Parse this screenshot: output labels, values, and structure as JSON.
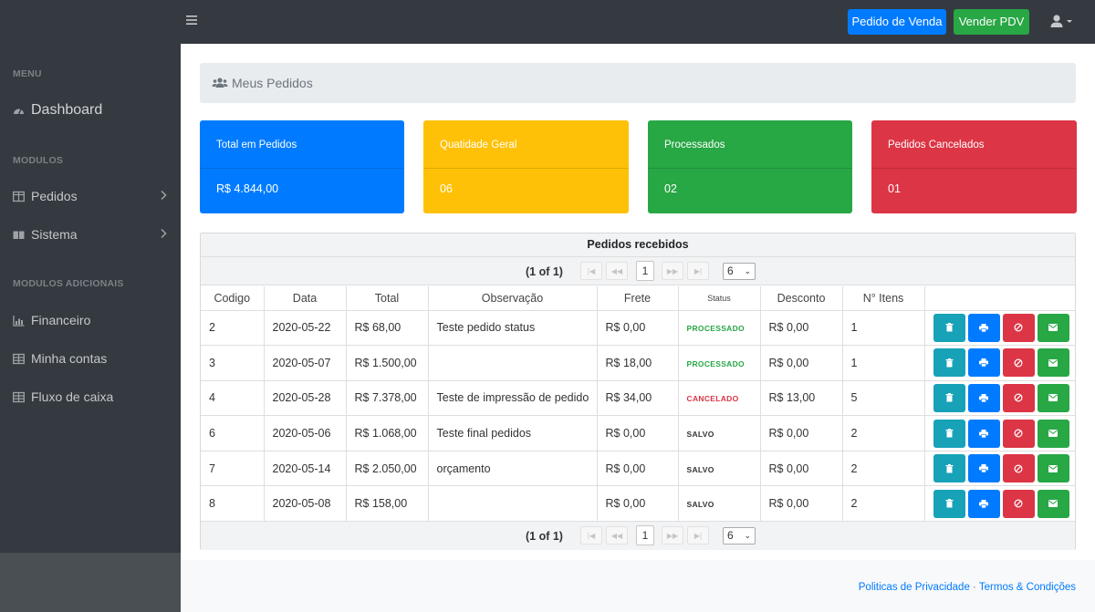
{
  "topbar": {
    "menu_icon": "hamburger-icon",
    "btn_pedido": "Pedido de Venda",
    "btn_pdv": "Vender PDV",
    "user_icon": "user-icon"
  },
  "sidebar": {
    "heading_menu": "MENU",
    "dashboard": "Dashboard",
    "heading_modulos": "MODULOS",
    "pedidos": "Pedidos",
    "sistema": "Sistema",
    "heading_adicionais": "MODULOS ADICIONAIS",
    "financeiro": "Financeiro",
    "minha_contas": "Minha contas",
    "fluxo_caixa": "Fluxo de caixa"
  },
  "breadcrumb": {
    "title": "Meus Pedidos",
    "icon": "users-icon"
  },
  "cards": [
    {
      "title": "Total em Pedidos",
      "value": "R$ 4.844,00",
      "color": "#007bff"
    },
    {
      "title": "Quatidade Geral",
      "value": "06",
      "color": "#ffc107"
    },
    {
      "title": "Processados",
      "value": "02",
      "color": "#28a745"
    },
    {
      "title": "Pedidos Cancelados",
      "value": "01",
      "color": "#dc3545"
    }
  ],
  "table": {
    "title": "Pedidos recebidos",
    "page_count": "(1 of 1)",
    "current_page": "1",
    "rows_per_page": "6",
    "columns": [
      "Codigo",
      "Data",
      "Total",
      "Observação",
      "Frete",
      "Status",
      "Desconto",
      "N° Itens",
      ""
    ],
    "rows": [
      {
        "codigo": "2",
        "data": "2020-05-22",
        "total": "R$ 68,00",
        "obs": "Teste pedido status",
        "frete": "R$ 0,00",
        "status": "PROCESSADO",
        "desconto": "R$ 0,00",
        "itens": "1"
      },
      {
        "codigo": "3",
        "data": "2020-05-07",
        "total": "R$ 1.500,00",
        "obs": "",
        "frete": "R$ 18,00",
        "status": "PROCESSADO",
        "desconto": "R$ 0,00",
        "itens": "1"
      },
      {
        "codigo": "4",
        "data": "2020-05-28",
        "total": "R$ 7.378,00",
        "obs": "Teste de impressão de pedido",
        "frete": "R$ 34,00",
        "status": "CANCELADO",
        "desconto": "R$ 13,00",
        "itens": "5"
      },
      {
        "codigo": "6",
        "data": "2020-05-06",
        "total": "R$ 1.068,00",
        "obs": "Teste final pedidos",
        "frete": "R$ 0,00",
        "status": "SALVO",
        "desconto": "R$ 0,00",
        "itens": "2"
      },
      {
        "codigo": "7",
        "data": "2020-05-14",
        "total": "R$ 2.050,00",
        "obs": "orçamento",
        "frete": "R$ 0,00",
        "status": "SALVO",
        "desconto": "R$ 0,00",
        "itens": "2"
      },
      {
        "codigo": "8",
        "data": "2020-05-08",
        "total": "R$ 158,00",
        "obs": "",
        "frete": "R$ 0,00",
        "status": "SALVO",
        "desconto": "R$ 0,00",
        "itens": "2"
      }
    ],
    "status_colors": {
      "PROCESSADO": "#28a745",
      "CANCELADO": "#dc3545",
      "SALVO": "#333333"
    },
    "action_icons": [
      "trash-icon",
      "print-icon",
      "ban-icon",
      "envelope-icon"
    ]
  },
  "footer": {
    "privacy": "Politicas de Privacidade",
    "separator": "·",
    "terms": "Termos & Condições"
  }
}
